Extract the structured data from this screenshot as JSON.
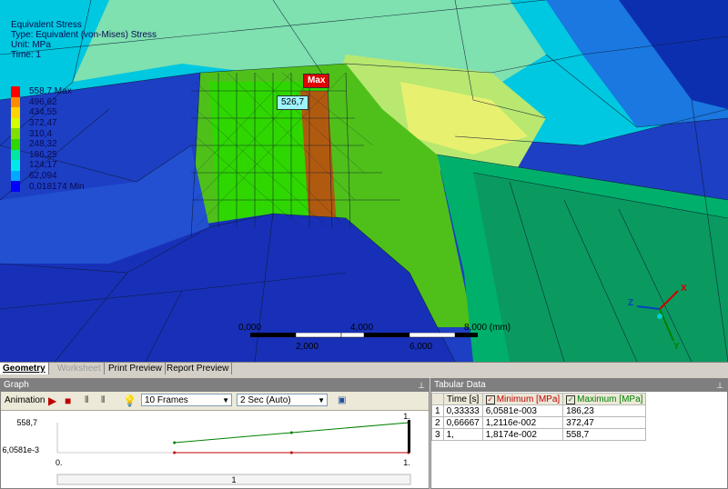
{
  "viewport": {
    "header": {
      "title": "Equivalent Stress",
      "type": "Type: Equivalent (von-Mises) Stress",
      "unit": "Unit: MPa",
      "time": "Time: 1"
    },
    "legend": [
      {
        "label": "558,7 Max",
        "color": "#ff0000"
      },
      {
        "label": "496,62",
        "color": "#ff8c00"
      },
      {
        "label": "434,55",
        "color": "#ffd400"
      },
      {
        "label": "372,47",
        "color": "#d4ff00"
      },
      {
        "label": "310,4",
        "color": "#7fe000"
      },
      {
        "label": "248,32",
        "color": "#2fd700"
      },
      {
        "label": "186,25",
        "color": "#00e8a0"
      },
      {
        "label": "124,17",
        "color": "#00e8e8"
      },
      {
        "label": "62,094",
        "color": "#00a8ff"
      },
      {
        "label": "0,018174 Min",
        "color": "#0000ff"
      }
    ],
    "probe_max_label": "Max",
    "probe_value_label": "526,7",
    "scale_labels": {
      "l0": "0,000",
      "l1": "4,000",
      "l2": "8,000 (mm)",
      "l3": "2,000",
      "l4": "6,000"
    },
    "triad": {
      "x": "X",
      "y": "Y",
      "z": "Z"
    }
  },
  "tabs": [
    {
      "label": "Geometry",
      "state": "active"
    },
    {
      "label": "Worksheet",
      "state": "disabled"
    },
    {
      "label": "Print Preview",
      "state": "normal"
    },
    {
      "label": "Report Preview",
      "state": "normal"
    }
  ],
  "graph": {
    "title": "Graph",
    "animation_label": "Animation",
    "frames_value": "10 Frames",
    "speed_value": "2 Sec (Auto)",
    "y_max_label": "558,7",
    "y_min_label": "6,0581e-3",
    "x_start_label": "0.",
    "x_end_label": "1.",
    "x_end_top_label": "1.",
    "slider_label": "1",
    "series_colors": {
      "maximum": "#008000",
      "minimum": "#c00000"
    }
  },
  "tabular": {
    "title": "Tabular Data",
    "columns": [
      "Time [s]",
      "Minimum [MPa]",
      "Maximum [MPa]"
    ],
    "rows": [
      {
        "index": "1",
        "time": "0,33333",
        "min": "6,0581e-003",
        "max": "186,23"
      },
      {
        "index": "2",
        "time": "0,66667",
        "min": "1,2116e-002",
        "max": "372,47"
      },
      {
        "index": "3",
        "time": "1,",
        "min": "1,8174e-002",
        "max": "558,7"
      }
    ]
  },
  "chart_data": {
    "type": "line",
    "x": [
      0.33333,
      0.66667,
      1.0
    ],
    "series": [
      {
        "name": "Minimum [MPa]",
        "values": [
          0.0060581,
          0.012116,
          0.018174
        ]
      },
      {
        "name": "Maximum [MPa]",
        "values": [
          186.23,
          372.47,
          558.7
        ]
      }
    ],
    "xlim": [
      0,
      1
    ],
    "ylim": [
      0.0060581,
      558.7
    ]
  }
}
